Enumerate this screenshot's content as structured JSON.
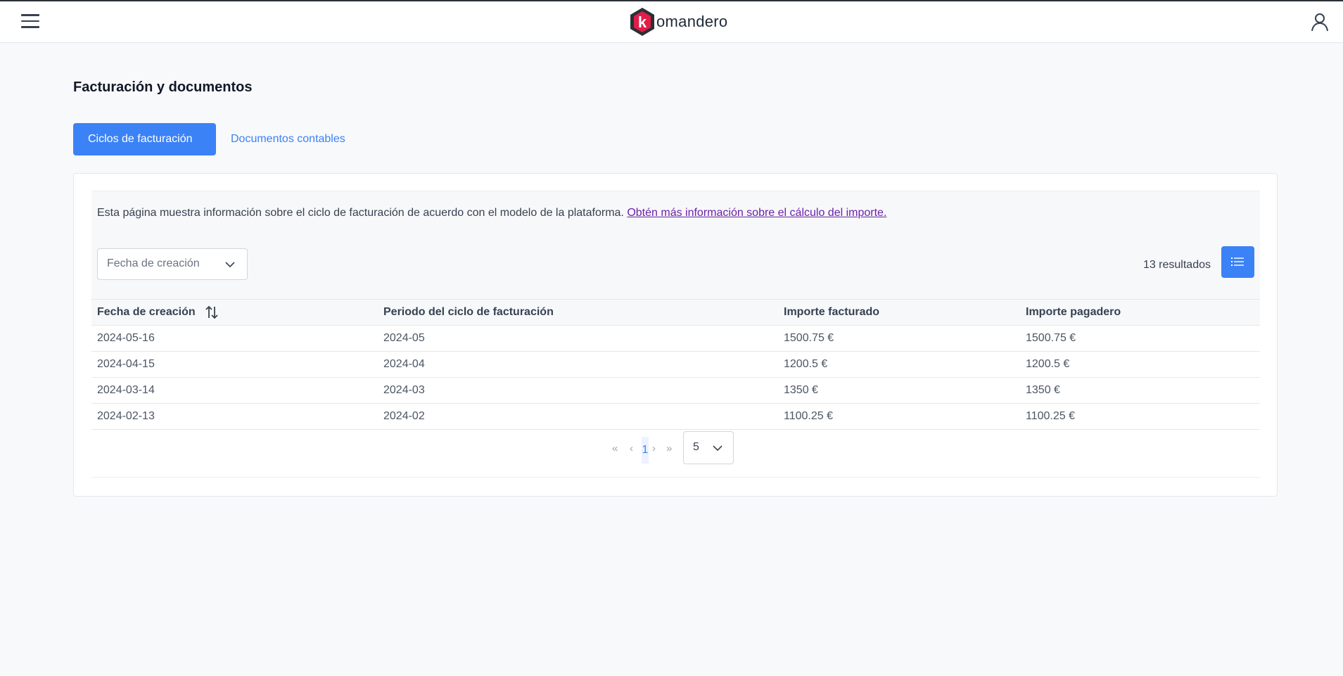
{
  "header": {
    "logo_letter": "k",
    "logo_text": "omandero",
    "menu_icon": "hamburger-menu-icon",
    "user_icon": "user-icon"
  },
  "page": {
    "title": "Facturación y documentos",
    "tabs": [
      {
        "label": "Ciclos de facturación",
        "active": true
      },
      {
        "label": "Documentos contables",
        "active": false
      }
    ]
  },
  "info": {
    "text": "Esta página muestra información sobre el ciclo de facturación de acuerdo con el modelo de la plataforma.",
    "link": "Obtén más información sobre el cálculo del importe."
  },
  "filters": {
    "sort_field": "Fecha de creación",
    "results": "13 resultados"
  },
  "table": {
    "headers": [
      "Fecha de creación",
      "Periodo del ciclo de facturación",
      "Importe facturado",
      "Importe pagadero"
    ],
    "rows": [
      [
        "2024-05-16",
        "2024-05",
        "1500.75 €",
        "1500.75 €"
      ],
      [
        "2024-04-15",
        "2024-04",
        "1200.5 €",
        "1200.5 €"
      ],
      [
        "2024-03-14",
        "2024-03",
        "1350 €",
        "1350 €"
      ],
      [
        "2024-02-13",
        "2024-02",
        "1100.25 €",
        "1100.25 €"
      ]
    ]
  },
  "pagination": {
    "first": "«",
    "prev": "‹",
    "current_page": "1",
    "next": "›",
    "last": "»",
    "page_size": "5"
  },
  "colors": {
    "accent": "#3b82f6",
    "logo_red": "#e11d48",
    "logo_dark": "#2b2f36",
    "link_visited": "#6b21a8"
  }
}
